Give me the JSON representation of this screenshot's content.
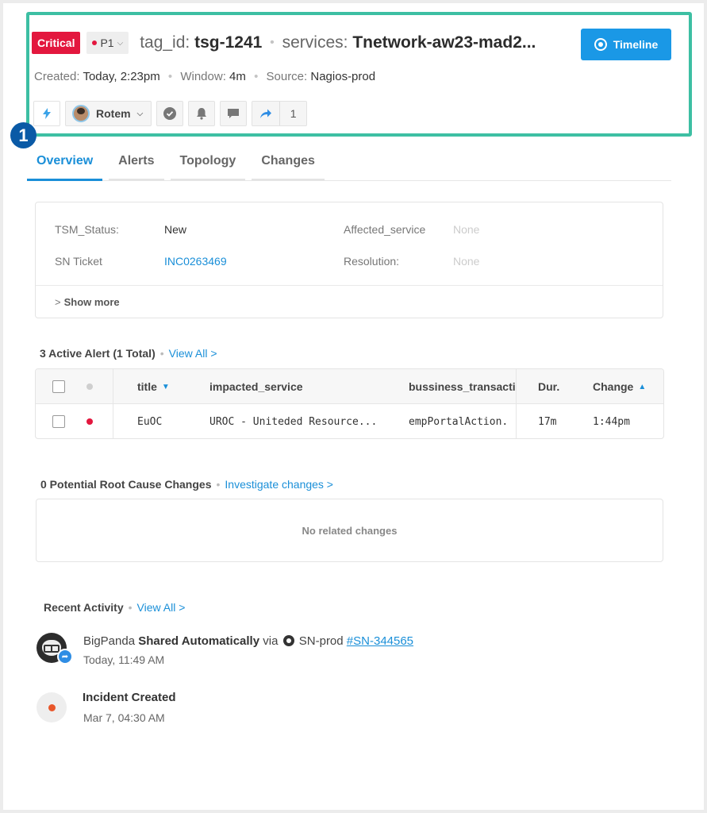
{
  "header": {
    "severity": "Critical",
    "priority": "P1",
    "tag_key": "tag_id:",
    "tag_value": "tsg-1241",
    "services_key": "services:",
    "services_value": "Tnetwork-aw23-mad2...",
    "timeline_label": "Timeline"
  },
  "meta": {
    "created_label": "Created:",
    "created_value": "Today, 2:23pm",
    "window_label": "Window:",
    "window_value": "4m",
    "source_label": "Source:",
    "source_value": "Nagios-prod"
  },
  "toolbar": {
    "assignee": "Rotem",
    "share_count": "1"
  },
  "step_badge": "1",
  "tabs": [
    "Overview",
    "Alerts",
    "Topology",
    "Changes"
  ],
  "details": {
    "tsm_status_label": "TSM_Status:",
    "tsm_status_value": "New",
    "sn_ticket_label": "SN Ticket",
    "sn_ticket_value": "INC0263469",
    "affected_service_label": "Affected_service",
    "affected_service_value": "None",
    "resolution_label": "Resolution:",
    "resolution_value": "None",
    "show_more": "Show more"
  },
  "alerts_section": {
    "heading": "3 Active Alert (1 Total)",
    "view_all": "View All >",
    "columns": [
      "title",
      "impacted_service",
      "bussiness_transactio",
      "Dur.",
      "Change"
    ],
    "rows": [
      {
        "title": "EuOC",
        "impacted_service": "UROC - Uniteded Resource...",
        "business_transaction": "empPortalAction.",
        "duration": "17m",
        "change": "1:44pm",
        "status_color": "#e3173e"
      }
    ]
  },
  "changes_section": {
    "heading": "0 Potential Root Cause Changes",
    "investigate": "Investigate changes  >",
    "empty": "No related changes"
  },
  "activity_section": {
    "heading": "Recent Activity",
    "view_all": "View All >",
    "items": [
      {
        "actor": "BigPanda",
        "action": "Shared Automatically",
        "via": "via",
        "channel": "SN-prod",
        "ticket": "#SN-344565",
        "time": "Today, 11:49 AM"
      },
      {
        "action": "Incident Created",
        "time": "Mar 7, 04:30 AM"
      }
    ]
  },
  "colors": {
    "critical": "#e3173e",
    "accent": "#1a98e6",
    "highlight": "#3dbfa3",
    "badge": "#0a5aa6"
  }
}
